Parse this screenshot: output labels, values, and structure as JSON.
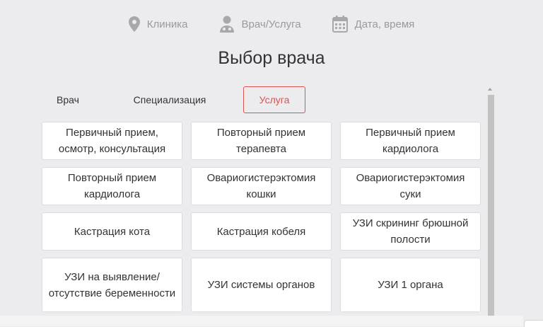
{
  "steps": [
    {
      "label": "Клиника",
      "icon": "map-pin-icon"
    },
    {
      "label": "Врач/Услуга",
      "icon": "doctor-icon"
    },
    {
      "label": "Дата, время",
      "icon": "calendar-icon"
    }
  ],
  "title": "Выбор врача",
  "tabs": [
    {
      "label": "Врач",
      "active": false
    },
    {
      "label": "Специализация",
      "active": false
    },
    {
      "label": "Услуга",
      "active": true
    }
  ],
  "services": [
    "Первичный прием, осмотр, консультация",
    "Повторный прием терапевта",
    "Первичный прием кардиолога",
    "Повторный прием кардиолога",
    "Овариогистерэктомия кошки",
    "Овариогистерэктомия суки",
    "Кастрация кота",
    "Кастрация кобеля",
    "УЗИ скрининг брюшной полости",
    "УЗИ на выявление/ отсутствие беременности",
    "УЗИ системы органов",
    "УЗИ 1 органа"
  ],
  "colors": {
    "accent": "#d9534f",
    "step_text": "#9a9a9a",
    "background": "#ececee"
  }
}
